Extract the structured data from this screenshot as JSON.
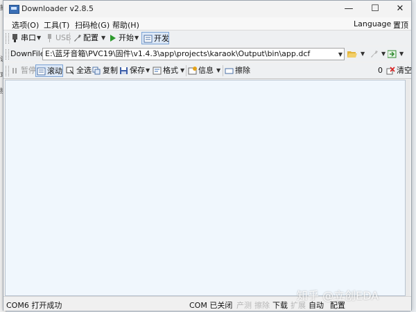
{
  "window": {
    "title": "Downloader v2.8.5"
  },
  "window_controls": {
    "minimize": "—",
    "maximize": "☐",
    "close": "✕"
  },
  "background_left": [
    "捕",
    "读",
    "式",
    "接"
  ],
  "menu": {
    "options": "选项(O)",
    "tools": "工具(T)",
    "scanner": "扫码枪(G)",
    "help": "帮助(H)",
    "language": "Language",
    "pin": "置顶"
  },
  "toolbar1": {
    "serial": "串口",
    "usb": "USB",
    "config": "配置",
    "start": "开始",
    "develop": "开发"
  },
  "toolbar2": {
    "downfile_label": "DownFile",
    "path": "E:\\蓝牙音箱\\PVC19\\固件\\v1.4.3\\app\\projects\\karaok\\Output\\bin\\app.dcf"
  },
  "toolbar3": {
    "pause": "暂停",
    "scroll": "滚动",
    "select_all": "全选",
    "copy": "复制",
    "save": "保存",
    "format": "格式",
    "info": "信息",
    "erase": "擦除",
    "count": "0",
    "clear": "清空"
  },
  "status": {
    "port_status": "COM6 打开成功",
    "com_closed": "COM 已关闭",
    "produce": "产测",
    "erase": "擦除",
    "download": "下载",
    "expand": "扩展",
    "auto": "自动",
    "config": "配置"
  },
  "watermark": "知乎 @立创EDA",
  "colors": {
    "output_bg": "#f0f7fd",
    "toolbar_bg": "#eef0f2",
    "pressed_bg": "#dbe7f6"
  }
}
